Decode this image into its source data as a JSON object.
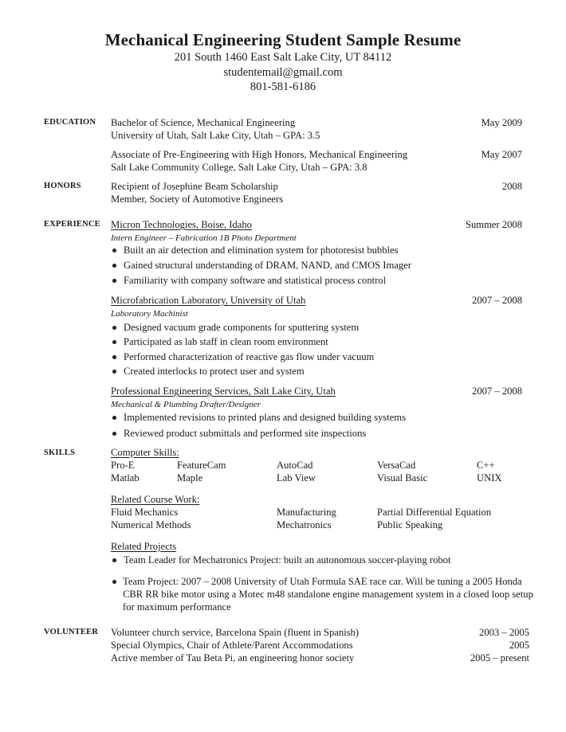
{
  "header": {
    "title": "Mechanical Engineering Student Sample Resume",
    "address": "201 South 1460 East Salt Lake City, UT 84112",
    "email": "studentemail@gmail.com",
    "phone": "801-581-6186"
  },
  "education": {
    "label": "EDUCATION",
    "entries": [
      {
        "degree": "Bachelor of Science, Mechanical Engineering",
        "school": "University of Utah, Salt Lake City, Utah – GPA: 3.5",
        "date": "May 2009"
      },
      {
        "degree": "Associate of Pre-Engineering with High Honors, Mechanical Engineering",
        "school": "Salt Lake Community College, Salt Lake City, Utah – GPA: 3.8",
        "date": "May 2007"
      }
    ]
  },
  "honors": {
    "label": "HONORS",
    "items": [
      "Recipient of Josephine Beam Scholarship",
      "Member, Society of Automotive Engineers"
    ],
    "date": "2008"
  },
  "experience": {
    "label": "EXPERIENCE",
    "jobs": [
      {
        "employer": "Micron Technologies, Boise, Idaho",
        "title": "Intern Engineer – Fabrication 1B Photo Department",
        "date": "Summer 2008",
        "bullets": [
          "Built an air detection and elimination system for photoresist bubbles",
          "Gained structural understanding of DRAM, NAND, and CMOS Imager",
          "Familiarity with company software and statistical process control"
        ]
      },
      {
        "employer": "Microfabrication Laboratory, University of Utah",
        "title": "Laboratory Machinist",
        "date": "2007 – 2008",
        "bullets": [
          "Designed vacuum grade components for sputtering system",
          "Participated as lab staff in clean room environment",
          "Performed characterization of reactive gas flow under vacuum",
          "Created interlocks to protect user and system"
        ]
      },
      {
        "employer": "Professional Engineering Services, Salt Lake City, Utah",
        "title": "Mechanical & Plumbing Drafter/Designer",
        "date": "2007 – 2008",
        "bullets": [
          "Implemented revisions to printed plans and designed building systems",
          "Reviewed product submittals and performed site inspections"
        ]
      }
    ]
  },
  "skills": {
    "label": "SKILLS",
    "computer_heading": "Computer Skills:",
    "computer_rows": [
      [
        "Pro-E",
        "FeatureCam",
        "AutoCad",
        "VersaCad",
        "C++"
      ],
      [
        "Matlab",
        "Maple",
        "Lab View",
        "Visual Basic",
        "UNIX"
      ]
    ],
    "course_heading": "Related Course Work:",
    "course_rows": [
      [
        "Fluid Mechanics",
        "Manufacturing",
        "Partial Differential Equation"
      ],
      [
        "Numerical Methods",
        "Mechatronics",
        "Public Speaking"
      ]
    ],
    "projects_heading": "Related Projects",
    "projects": [
      "Team Leader for Mechatronics Project: built an autonomous soccer-playing robot",
      "Team Project: 2007 – 2008 University of Utah Formula SAE race car.  Will be tuning a 2005 Honda CBR RR bike motor using a Motec m48 standalone engine management system in a closed loop setup for maximum performance"
    ]
  },
  "volunteer": {
    "label": "VOLUNTEER",
    "items": [
      {
        "text": "Volunteer church service, Barcelona Spain (fluent in Spanish)",
        "date": "2003 – 2005"
      },
      {
        "text": "Special Olympics, Chair of Athlete/Parent Accommodations",
        "date": "2005"
      },
      {
        "text": "Active member of Tau Beta Pi, an engineering honor society",
        "date": "2005 – present"
      }
    ]
  }
}
